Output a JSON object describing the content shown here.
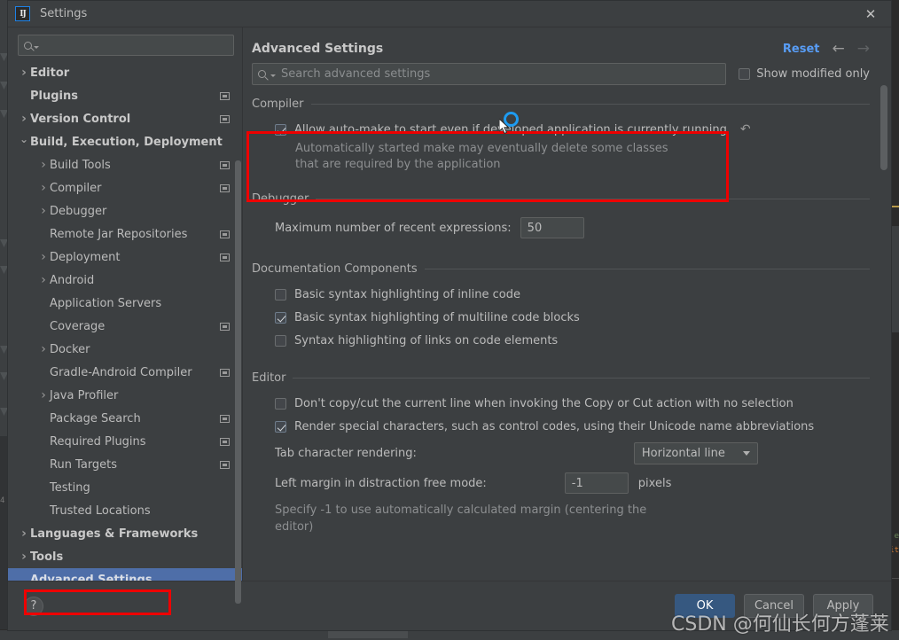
{
  "window": {
    "title": "Settings",
    "logo_text": "IJ",
    "close_icon": "close-icon"
  },
  "sidebar": {
    "search_placeholder": "",
    "items": [
      {
        "label": "Editor",
        "indent": 0,
        "chevron": "closed",
        "bold": true,
        "project_icon": false,
        "selected": false
      },
      {
        "label": "Plugins",
        "indent": 0,
        "chevron": "none",
        "bold": true,
        "project_icon": true,
        "selected": false
      },
      {
        "label": "Version Control",
        "indent": 0,
        "chevron": "closed",
        "bold": true,
        "project_icon": true,
        "selected": false
      },
      {
        "label": "Build, Execution, Deployment",
        "indent": 0,
        "chevron": "open",
        "bold": true,
        "project_icon": false,
        "selected": false
      },
      {
        "label": "Build Tools",
        "indent": 1,
        "chevron": "closed",
        "bold": false,
        "project_icon": true,
        "selected": false
      },
      {
        "label": "Compiler",
        "indent": 1,
        "chevron": "closed",
        "bold": false,
        "project_icon": true,
        "selected": false
      },
      {
        "label": "Debugger",
        "indent": 1,
        "chevron": "closed",
        "bold": false,
        "project_icon": false,
        "selected": false
      },
      {
        "label": "Remote Jar Repositories",
        "indent": 1,
        "chevron": "none",
        "bold": false,
        "project_icon": true,
        "selected": false
      },
      {
        "label": "Deployment",
        "indent": 1,
        "chevron": "closed",
        "bold": false,
        "project_icon": true,
        "selected": false
      },
      {
        "label": "Android",
        "indent": 1,
        "chevron": "closed",
        "bold": false,
        "project_icon": false,
        "selected": false
      },
      {
        "label": "Application Servers",
        "indent": 1,
        "chevron": "none",
        "bold": false,
        "project_icon": false,
        "selected": false
      },
      {
        "label": "Coverage",
        "indent": 1,
        "chevron": "none",
        "bold": false,
        "project_icon": true,
        "selected": false
      },
      {
        "label": "Docker",
        "indent": 1,
        "chevron": "closed",
        "bold": false,
        "project_icon": false,
        "selected": false
      },
      {
        "label": "Gradle-Android Compiler",
        "indent": 1,
        "chevron": "none",
        "bold": false,
        "project_icon": true,
        "selected": false
      },
      {
        "label": "Java Profiler",
        "indent": 1,
        "chevron": "closed",
        "bold": false,
        "project_icon": false,
        "selected": false
      },
      {
        "label": "Package Search",
        "indent": 1,
        "chevron": "none",
        "bold": false,
        "project_icon": true,
        "selected": false
      },
      {
        "label": "Required Plugins",
        "indent": 1,
        "chevron": "none",
        "bold": false,
        "project_icon": true,
        "selected": false
      },
      {
        "label": "Run Targets",
        "indent": 1,
        "chevron": "none",
        "bold": false,
        "project_icon": true,
        "selected": false
      },
      {
        "label": "Testing",
        "indent": 1,
        "chevron": "none",
        "bold": false,
        "project_icon": false,
        "selected": false
      },
      {
        "label": "Trusted Locations",
        "indent": 1,
        "chevron": "none",
        "bold": false,
        "project_icon": false,
        "selected": false
      },
      {
        "label": "Languages & Frameworks",
        "indent": 0,
        "chevron": "closed",
        "bold": true,
        "project_icon": false,
        "selected": false
      },
      {
        "label": "Tools",
        "indent": 0,
        "chevron": "closed",
        "bold": true,
        "project_icon": false,
        "selected": false
      },
      {
        "label": "Advanced Settings",
        "indent": 0,
        "chevron": "none",
        "bold": true,
        "project_icon": false,
        "selected": true
      }
    ]
  },
  "main": {
    "title": "Advanced Settings",
    "reset_label": "Reset",
    "back_icon": "arrow-left-icon",
    "forward_icon": "arrow-right-icon",
    "search_placeholder": "Search advanced settings",
    "show_modified_label": "Show modified only",
    "show_modified_checked": false,
    "sections": [
      {
        "name": "Compiler",
        "options": [
          {
            "label": "Allow auto-make to start even if developed application is currently running",
            "checked": true,
            "has_revert": true,
            "revert_icon": "revert-arrow-icon",
            "description": "Automatically started make may eventually delete some classes that are required by the application"
          }
        ]
      },
      {
        "name": "Debugger",
        "fields": [
          {
            "label": "Maximum number of recent expressions:",
            "type": "text",
            "value": "50"
          }
        ]
      },
      {
        "name": "Documentation Components",
        "options": [
          {
            "label": "Basic syntax highlighting of inline code",
            "checked": false
          },
          {
            "label": "Basic syntax highlighting of multiline code blocks",
            "checked": true
          },
          {
            "label": "Syntax highlighting of links on code elements",
            "checked": false
          }
        ]
      },
      {
        "name": "Editor",
        "options": [
          {
            "label": "Don't copy/cut the current line when invoking the Copy or Cut action with no selection",
            "checked": false
          },
          {
            "label": "Render special characters, such as control codes, using their Unicode name abbreviations",
            "checked": true
          }
        ],
        "fields": [
          {
            "label": "Tab character rendering:",
            "type": "combo",
            "value": "Horizontal line"
          },
          {
            "label": "Left margin in distraction free mode:",
            "type": "text",
            "value": "-1",
            "unit": "pixels"
          }
        ],
        "hint": "Specify -1 to use automatically calculated margin (centering the editor)"
      }
    ]
  },
  "footer": {
    "help_label": "?",
    "ok_label": "OK",
    "cancel_label": "Cancel",
    "apply_label": "Apply"
  },
  "watermark": "CSDN @何仙长何方蓬莱",
  "background": {
    "left_line_number": "4",
    "code_fragment_1": "e",
    "code_fragment_2": "it"
  },
  "colors": {
    "accent_blue": "#589df6",
    "selection_blue": "#4e6ea8",
    "annotation_red": "#ee0000",
    "primary_button": "#365880",
    "panel_bg": "#3c3f41"
  }
}
